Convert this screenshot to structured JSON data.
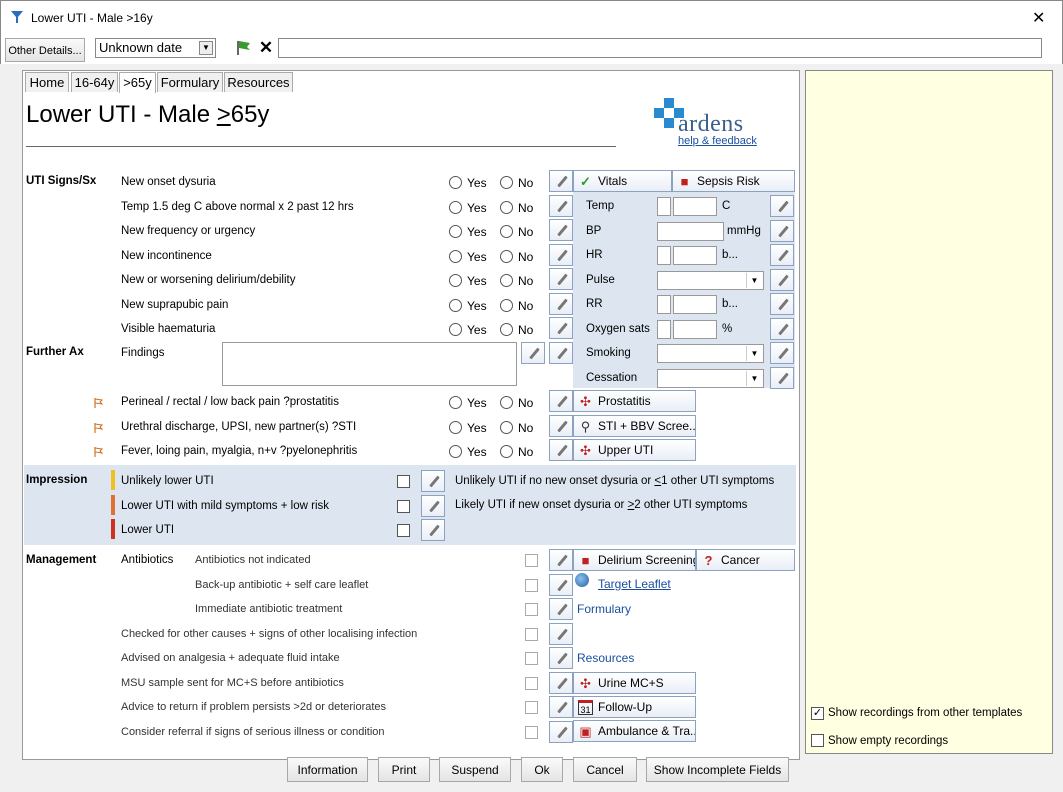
{
  "window": {
    "title": "Lower UTI - Male >16y"
  },
  "toolbar": {
    "other_details": "Other Details...",
    "date": "Unknown date"
  },
  "tabs": [
    "Home",
    "16-64y",
    ">65y",
    "Formulary",
    "Resources"
  ],
  "page": {
    "title_pre": "Lower UTI - Male ",
    "title_ge": ">",
    "title_post": "65y"
  },
  "logo": {
    "name": "ardens",
    "link": "help & feedback"
  },
  "radio": {
    "yes": "Yes",
    "no": "No"
  },
  "signs": {
    "section": "UTI Signs/Sx",
    "items": [
      "New onset dysuria",
      "Temp 1.5 deg C above normal x 2 past 12 hrs",
      "New frequency or urgency",
      "New incontinence",
      "New or worsening delirium/debility",
      "New suprapubic pain",
      "Visible haematuria"
    ]
  },
  "vitals": {
    "tab_vitals": "Vitals",
    "tab_sepsis": "Sepsis Risk",
    "rows": [
      {
        "label": "Temp",
        "unit": "C"
      },
      {
        "label": "BP",
        "unit": "mmHg"
      },
      {
        "label": "HR",
        "unit": "b..."
      },
      {
        "label": "Pulse",
        "unit": ""
      },
      {
        "label": "RR",
        "unit": "b..."
      },
      {
        "label": "Oxygen sats",
        "unit": "%"
      },
      {
        "label": "Smoking",
        "unit": ""
      },
      {
        "label": "Cessation",
        "unit": ""
      }
    ]
  },
  "further": {
    "section": "Further Ax",
    "findings": "Findings",
    "items": [
      {
        "label": "Perineal / rectal / low back pain ?prostatitis",
        "button": "Prostatitis"
      },
      {
        "label": "Urethral discharge, UPSI, new partner(s) ?STI",
        "button": "STI + BBV Scree..."
      },
      {
        "label": "Fever, loing pain, myalgia, n+v ?pyelonephritis",
        "button": "Upper UTI"
      }
    ]
  },
  "impression": {
    "section": "Impression",
    "items": [
      {
        "label": "Unlikely lower UTI",
        "color": "#f0c020"
      },
      {
        "label": "Lower UTI with mild symptoms + low risk",
        "color": "#e07030"
      },
      {
        "label": "Lower UTI",
        "color": "#d03020"
      }
    ],
    "note1_pre": "Unlikely UTI if no new onset dysuria or ",
    "note1_le": "<",
    "note1_post": "1 other UTI symptoms",
    "note2_pre": "Likely UTI if new onset dysuria or ",
    "note2_ge": ">",
    "note2_post": "2 other UTI symptoms"
  },
  "management": {
    "section": "Management",
    "antibiotics": "Antibiotics",
    "items": [
      "Antibiotics not indicated",
      "Back-up antibiotic + self care leaflet",
      "Immediate antibiotic treatment",
      "Checked for other causes + signs of other localising infection",
      "Advised on analgesia + adequate fluid intake",
      "MSU sample sent for MC+S before antibiotics",
      "Advice to return if problem persists >2d or deteriorates",
      "Consider referral if signs of serious illness or condition"
    ],
    "delirium": "Delirium Screening",
    "cancer": "Cancer",
    "target_leaflet": "Target Leaflet",
    "formulary": "Formulary",
    "resources": "Resources",
    "urine": "Urine MC+S",
    "followup": "Follow-Up",
    "ambulance": "Ambulance & Tra..."
  },
  "side": {
    "show_other": "Show recordings from other templates",
    "show_empty": "Show empty recordings",
    "show_other_checked": true
  },
  "footer": [
    "Information",
    "Print",
    "Suspend",
    "Ok",
    "Cancel",
    "Show Incomplete Fields"
  ]
}
